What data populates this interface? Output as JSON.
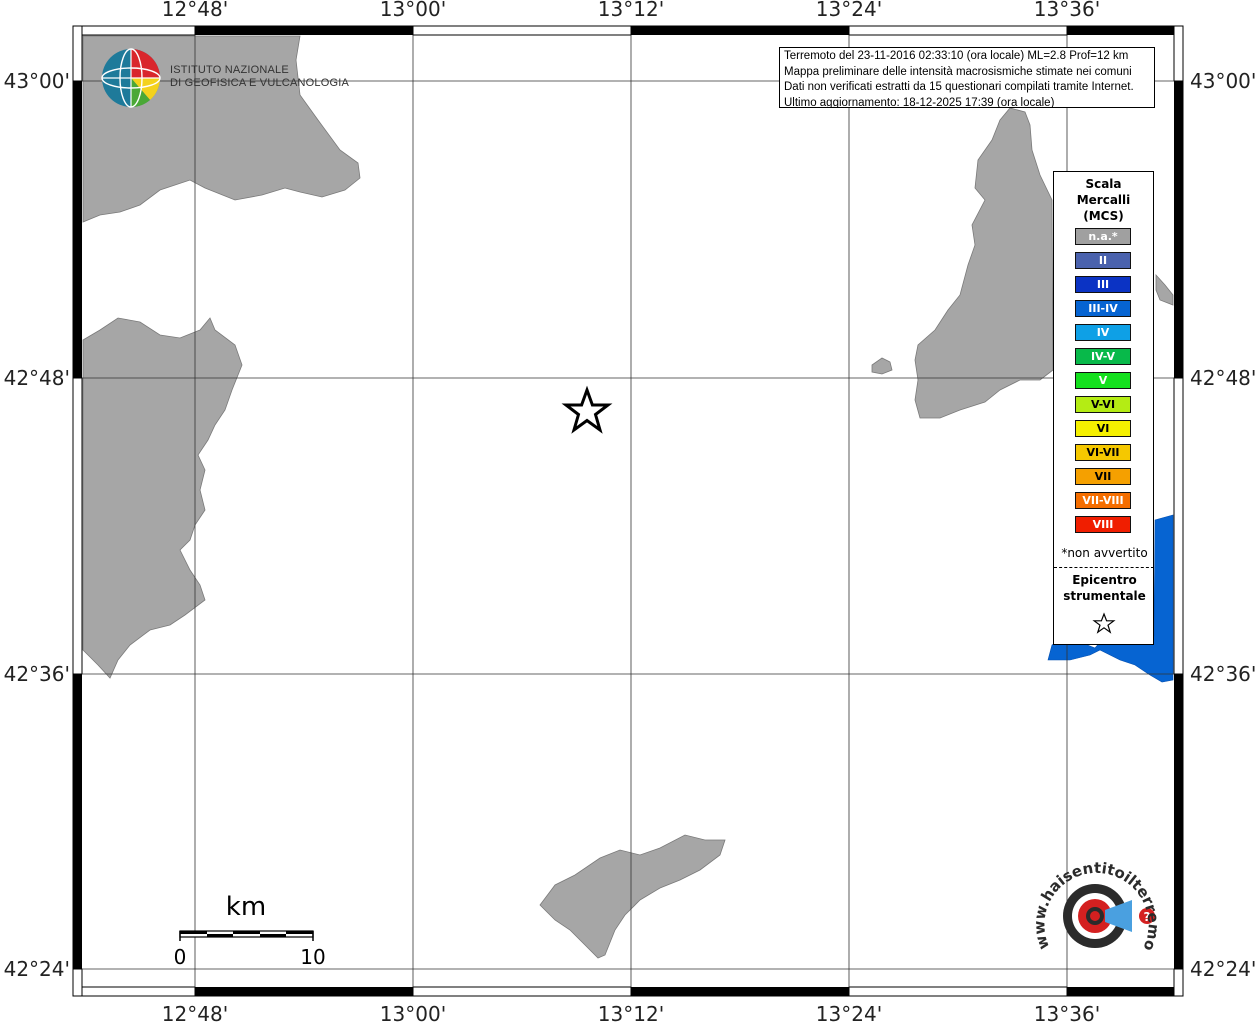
{
  "info": {
    "line1": "Terremoto del 23-11-2016 02:33:10 (ora locale) ML=2.8 Prof=12 km",
    "line2": "Mappa preliminare delle intensità macrosismiche stimate nei comuni",
    "line3": "Dati non verificati estratti da 15 questionari compilati tramite Internet.",
    "line4": "Ultimo aggiornamento: 18-12-2025 17:39 (ora locale)"
  },
  "logo": {
    "line1": "ISTITUTO NAZIONALE",
    "line2": "DI GEOFISICA E VULCANOLOGIA",
    "badge_text": "www.haisentitoilterremoto.it"
  },
  "axes": {
    "longitude_labels": [
      "12°48'",
      "13°00'",
      "13°12'",
      "13°24'",
      "13°36'"
    ],
    "latitude_labels": [
      "43°00'",
      "42°48'",
      "42°36'",
      "42°24'"
    ]
  },
  "scale_bar": {
    "unit": "km",
    "start": "0",
    "end": "10"
  },
  "legend": {
    "title_line1": "Scala",
    "title_line2": "Mercalli",
    "title_line3": "(MCS)",
    "classes": [
      {
        "label": "n.a.*",
        "color": "#a0a0a0"
      },
      {
        "label": "II",
        "color": "#4a62ad"
      },
      {
        "label": "III",
        "color": "#0b33c4"
      },
      {
        "label": "III-IV",
        "color": "#0664d2"
      },
      {
        "label": "IV",
        "color": "#0ea0e6"
      },
      {
        "label": "IV-V",
        "color": "#08b94a"
      },
      {
        "label": "V",
        "color": "#14e01e"
      },
      {
        "label": "V-VI",
        "color": "#b4ec14"
      },
      {
        "label": "VI",
        "color": "#f5f000"
      },
      {
        "label": "VI-VII",
        "color": "#f5c800"
      },
      {
        "label": "VII",
        "color": "#f5a000"
      },
      {
        "label": "VII-VIII",
        "color": "#f56e00"
      },
      {
        "label": "VIII",
        "color": "#f01e00"
      }
    ],
    "note": "*non avvertito",
    "epicenter_line1": "Epicentro",
    "epicenter_line2": "strumentale"
  },
  "colors": {
    "land": "#a6a6a6",
    "intensity_area": "#0664d2",
    "frame": "#000000"
  }
}
